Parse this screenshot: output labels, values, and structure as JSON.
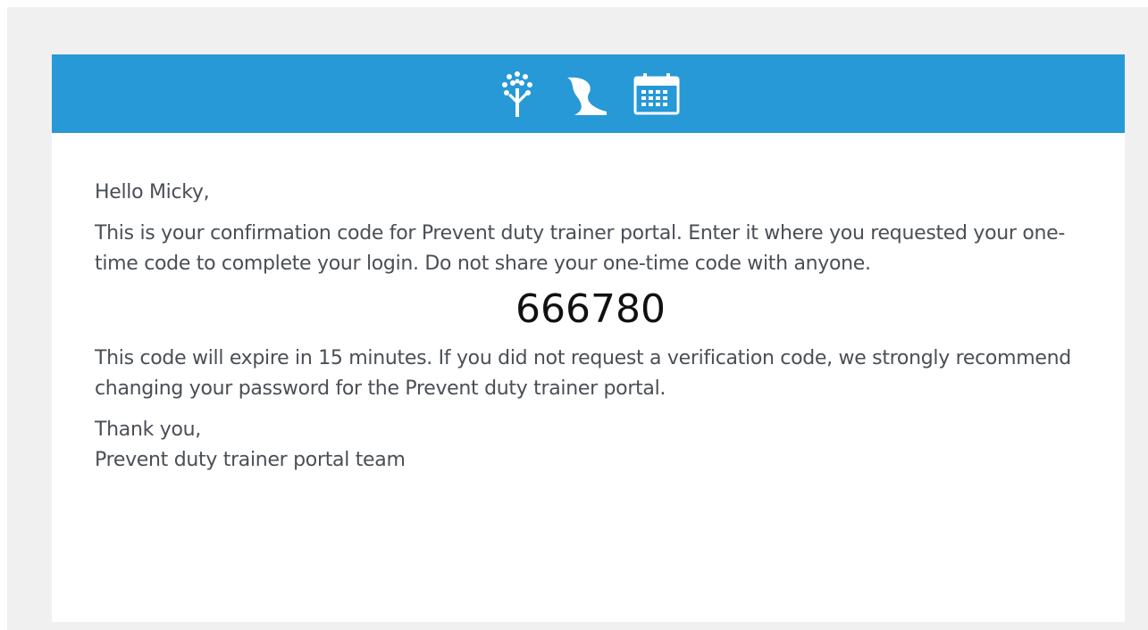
{
  "email": {
    "banner": {
      "color": "#2799d6",
      "icons": [
        "tree-icon",
        "road-icon",
        "calendar-icon"
      ]
    },
    "greeting": "Hello Micky,",
    "intro": "This is your confirmation code for Prevent duty trainer portal. Enter it where you requested your one-time code to complete your login. Do not share your one-time code with anyone.",
    "code": "666780",
    "expiry_notice": "This code will expire in 15 minutes. If you did not request a verification code, we strongly recommend changing your password for the Prevent duty trainer portal.",
    "signoff": "Thank you,",
    "team": "Prevent duty trainer portal team"
  }
}
